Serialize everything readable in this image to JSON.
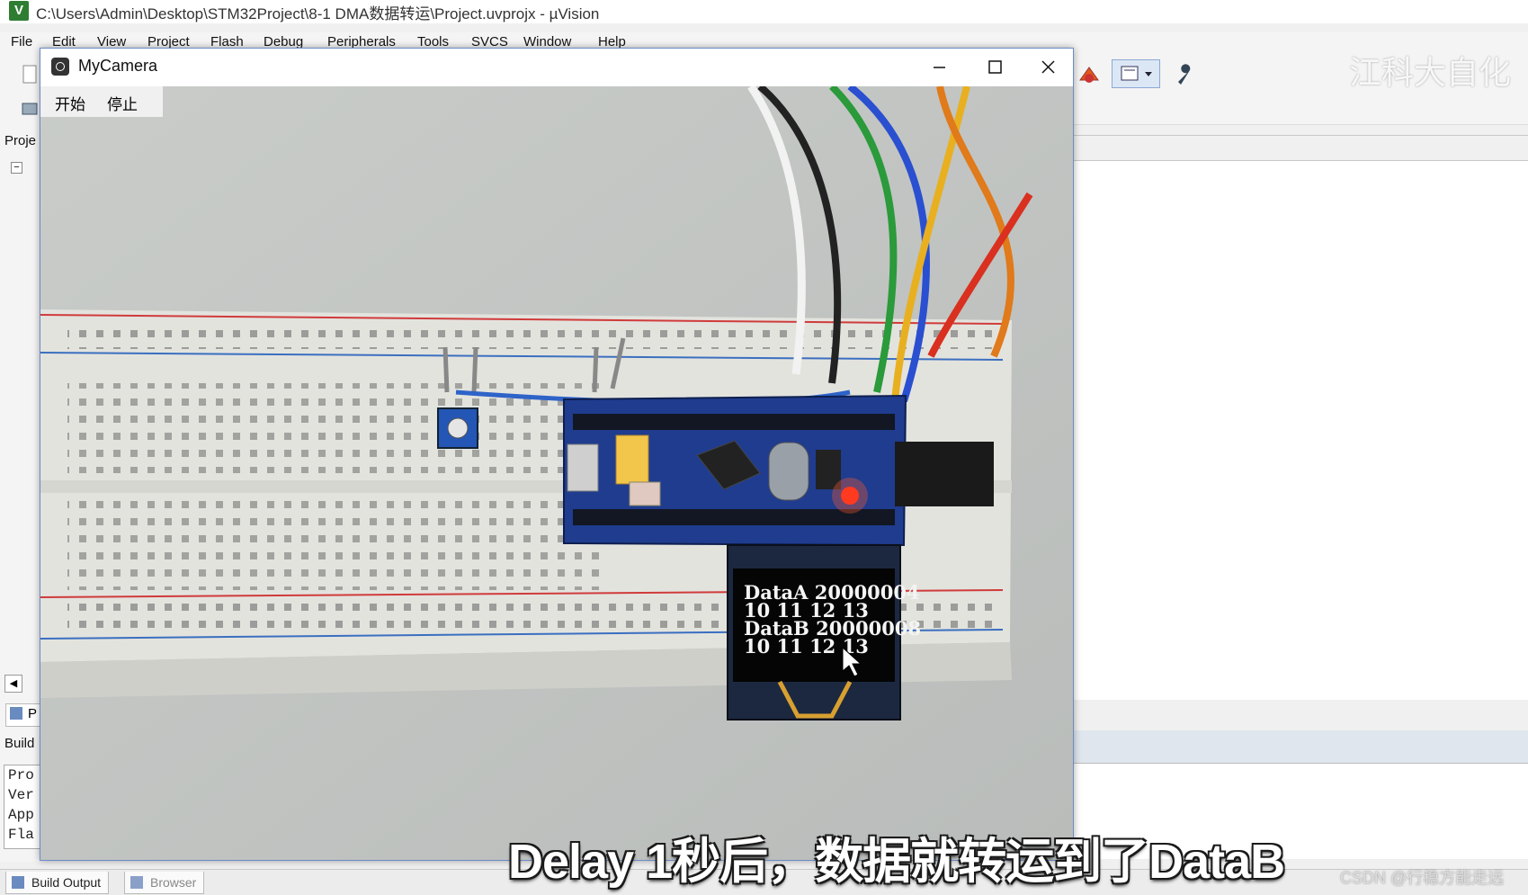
{
  "uvision": {
    "title": "C:\\Users\\Admin\\Desktop\\STM32Project\\8-1 DMA数据转运\\Project.uvprojx - µVision",
    "menu": [
      "File",
      "Edit",
      "View",
      "Project",
      "Flash",
      "Debug",
      "Peripherals",
      "Tools",
      "SVCS",
      "Window",
      "Help"
    ],
    "left_labels": {
      "project": "Proje",
      "panel_tab": "P",
      "build": "Build"
    },
    "build_output_lines": [
      "Pro",
      "Ver",
      "App",
      "Fla"
    ],
    "bottom_tabs": [
      "Build Output",
      "Browser"
    ],
    "watermark_top_right": "江科大自化"
  },
  "camera": {
    "title": "MyCamera",
    "toolbar": {
      "start": "开始",
      "stop": "停止"
    },
    "oled_lines": [
      "DataA  20000004",
      "10 11 12 13",
      "DataB  20000008",
      "10 11 12 13"
    ]
  },
  "subtitle": "Delay 1秒后，数据就转运到了DataB",
  "csdn_watermark": "CSDN @行稳方能走远",
  "colors": {
    "window_border": "#6b8cc7",
    "led": "#ff2a1a",
    "pcb": "#1f3c8f"
  }
}
